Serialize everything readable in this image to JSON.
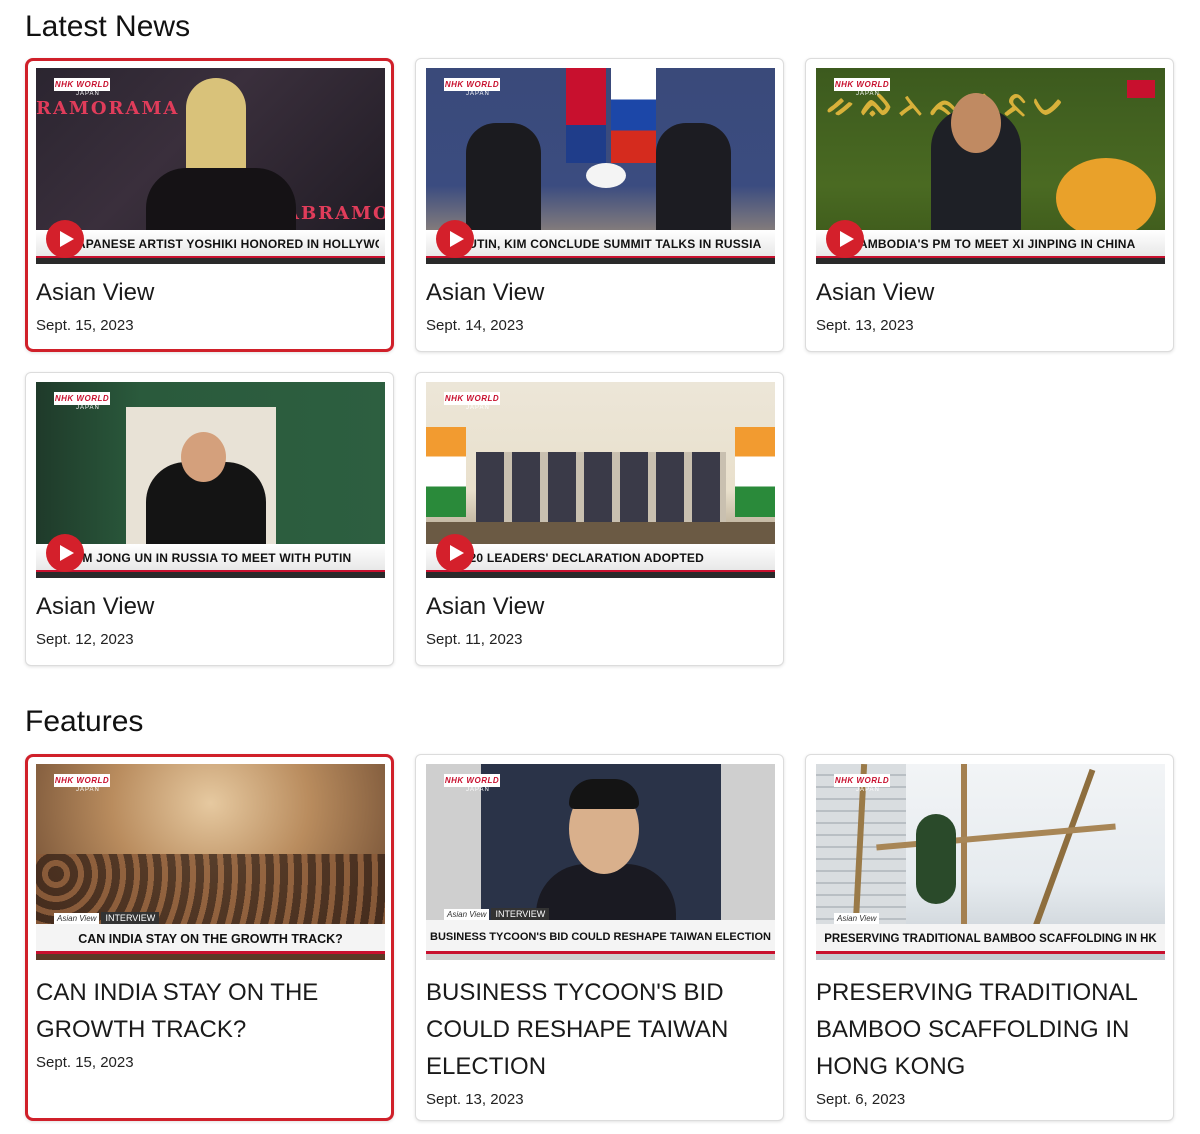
{
  "latest": {
    "title": "Latest News",
    "cards": [
      {
        "caption": "JAPANESE ARTIST YOSHIKI HONORED IN HOLLYWOOD IMPRINT CEREMONY",
        "title": "Asian View",
        "date": "Sept. 15, 2023",
        "selected": true
      },
      {
        "caption": "PUTIN, KIM CONCLUDE SUMMIT TALKS IN RUSSIA",
        "title": "Asian View",
        "date": "Sept. 14, 2023",
        "selected": false
      },
      {
        "caption": "CAMBODIA'S PM TO MEET XI JINPING IN CHINA",
        "title": "Asian View",
        "date": "Sept. 13, 2023",
        "selected": false
      },
      {
        "caption": "KIM JONG UN IN RUSSIA TO MEET WITH PUTIN",
        "title": "Asian View",
        "date": "Sept. 12, 2023",
        "selected": false
      },
      {
        "caption": "G20 LEADERS' DECLARATION ADOPTED",
        "title": "Asian View",
        "date": "Sept. 11, 2023",
        "selected": false
      }
    ]
  },
  "features": {
    "title": "Features",
    "cards": [
      {
        "caption": "CAN INDIA STAY ON THE GROWTH TRACK?",
        "title": "CAN INDIA STAY ON THE GROWTH TRACK?",
        "date": "Sept. 15, 2023",
        "selected": true,
        "tag": "INTERVIEW"
      },
      {
        "caption": "BUSINESS TYCOON'S BID COULD RESHAPE TAIWAN ELECTION",
        "title": "BUSINESS TYCOON'S BID COULD RESHAPE TAIWAN ELECTION",
        "date": "Sept. 13, 2023",
        "selected": false,
        "tag": "INTERVIEW"
      },
      {
        "caption": "PRESERVING TRADITIONAL BAMBOO SCAFFOLDING IN HK",
        "title": "PRESERVING TRADITIONAL BAMBOO SCAFFOLDING IN HONG KONG",
        "date": "Sept. 6, 2023",
        "selected": false,
        "tag": ""
      }
    ]
  },
  "branding": {
    "logo": "NHK WORLD",
    "logo_sub": "JAPAN",
    "program_tag": "Asian View",
    "accent_color": "#c8102e"
  }
}
